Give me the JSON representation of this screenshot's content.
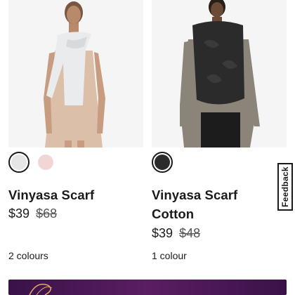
{
  "products": [
    {
      "name": "Vinyasa Scarf",
      "price": "$39",
      "original_price": "$68",
      "colours_label": "2 colours",
      "image_icon": "model-with-light-grey-scarf",
      "swatches": [
        {
          "color": "#e6e6e6",
          "selected": true,
          "name": "light-grey"
        },
        {
          "color": "#f2d6d6",
          "selected": false,
          "name": "light-pink"
        }
      ]
    },
    {
      "name": "Vinyasa Scarf Cotton",
      "price": "$39",
      "original_price": "$48",
      "colours_label": "1 colour",
      "image_icon": "model-with-black-camo-scarf",
      "swatches": [
        {
          "color": "#2b2b2b",
          "selected": true,
          "name": "black-camo"
        }
      ]
    }
  ],
  "feedback": {
    "label": "Feedback"
  },
  "colors": {
    "banner": "#4a1a56",
    "banner_accent": "#e0a96d"
  }
}
